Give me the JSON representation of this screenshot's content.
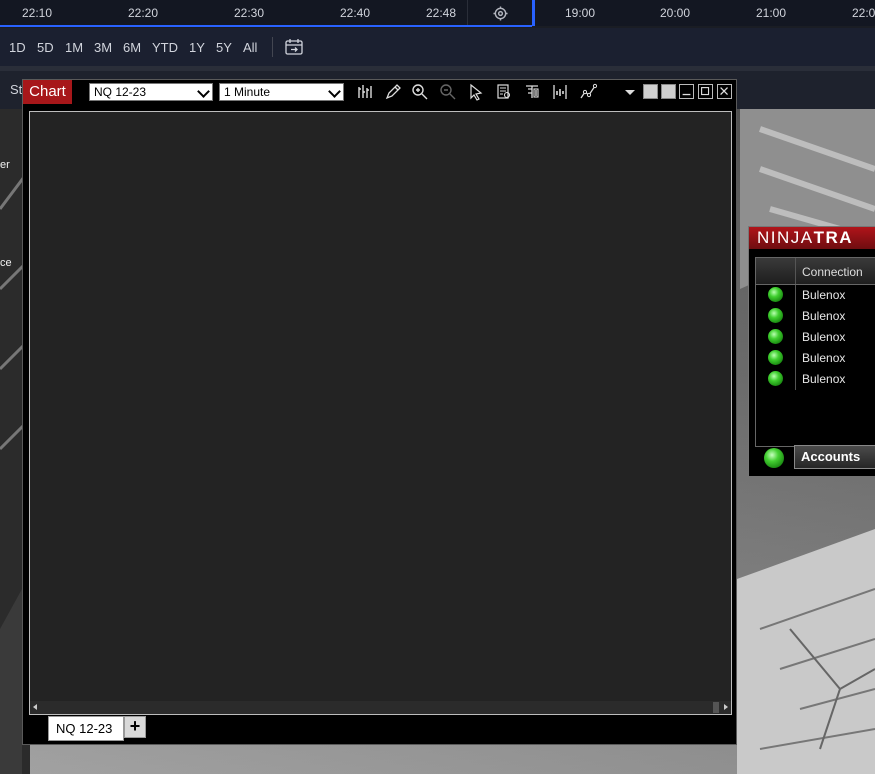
{
  "time_axis": {
    "left_labels": [
      "22:10",
      "22:20",
      "22:30",
      "22:40",
      "22:48"
    ],
    "right_labels": [
      "19:00",
      "20:00",
      "21:00",
      "22:0"
    ]
  },
  "range_buttons": [
    "1D",
    "5D",
    "1M",
    "3M",
    "6M",
    "YTD",
    "1Y",
    "5Y",
    "All"
  ],
  "row3": {
    "clipped_text": "St"
  },
  "desktop": {
    "clipped_labels": [
      "er",
      "ce"
    ]
  },
  "chart_window": {
    "title": "Chart",
    "instrument": "NQ 12-23",
    "interval": "1 Minute",
    "toolbar_icons": [
      "bar-type-icon",
      "pencil-icon",
      "zoom-in-icon",
      "zoom-out-icon",
      "cursor-icon",
      "data-box-icon",
      "properties-icon",
      "chart-trader-icon",
      "indicators-icon"
    ],
    "tab_label": "NQ 12-23",
    "add_tab": "+"
  },
  "control_center": {
    "logo_prefix": "NINJA",
    "logo_suffix": "TRA",
    "column_header": "Connection",
    "connections": [
      "Bulenox",
      "Bulenox",
      "Bulenox",
      "Bulenox",
      "Bulenox"
    ],
    "status_color": "#3fcf2e",
    "accounts_label": "Accounts"
  },
  "colors": {
    "accent_blue": "#2962ff",
    "ninja_red": "#a7171a"
  }
}
